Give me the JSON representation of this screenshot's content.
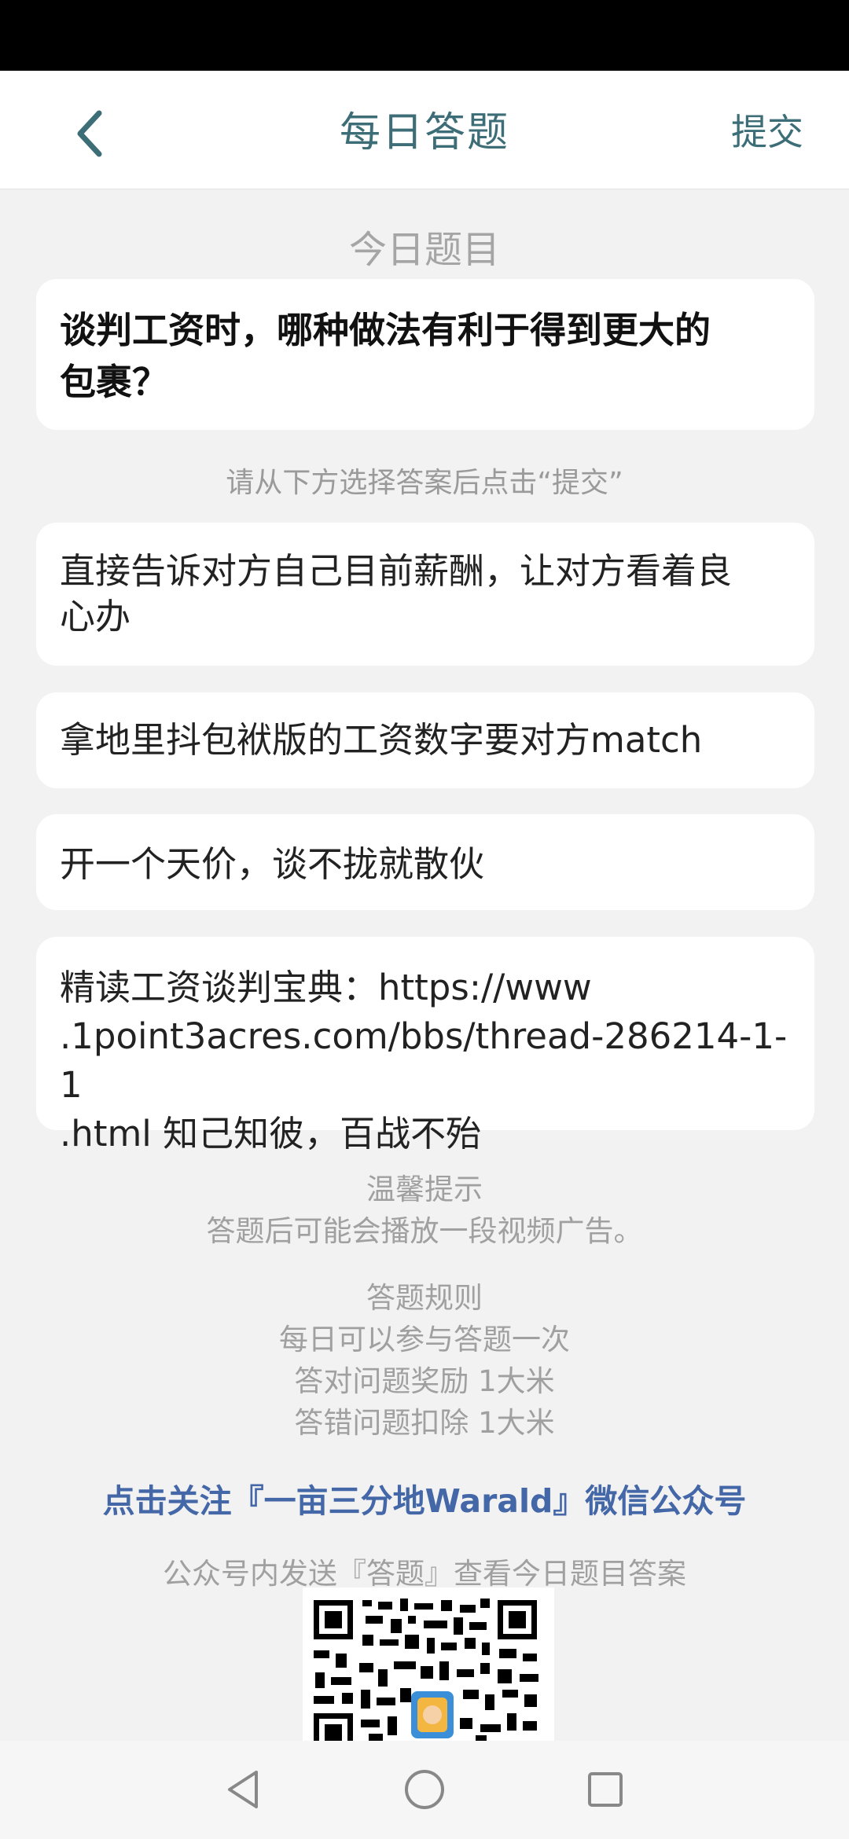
{
  "header": {
    "title": "每日答题",
    "submit_label": "提交"
  },
  "quiz": {
    "section_label": "今日题目",
    "question": "谈判工资时，哪种做法有利于得到更大的包裹？",
    "instruction": "请从下方选择答案后点击“提交”",
    "options": [
      "直接告诉对方自己目前薪酬，让对方看着良心办",
      "拿地里抖包袱版的工资数字要对方match",
      "开一个天价，谈不拢就散伙",
      "精读工资谈判宝典：https://www.1point3acres.com/bbs/thread-286214-1-1.html 知己知彼，百战不殆"
    ],
    "option4_lines": [
      "精读工资谈判宝典：https://www",
      ".1point3acres.com/bbs/thread-286214-1-1",
      ".html 知己知彼，百战不殆"
    ],
    "option1_lines": [
      "直接告诉对方自己目前薪酬，让对方看着良",
      "心办"
    ],
    "question_lines": [
      "谈判工资时，哪种做法有利于得到更大的",
      "包裹？"
    ]
  },
  "tips": {
    "title": "温馨提示",
    "text": "答题后可能会播放一段视频广告。"
  },
  "rules": {
    "title": "答题规则",
    "lines": [
      "每日可以参与答题一次",
      "答对问题奖励 1大米",
      "答错问题扣除 1大米"
    ]
  },
  "follow": {
    "link_text": "点击关注『一亩三分地Warald』微信公众号",
    "instruction": "公众号内发送『答题』查看今日题目答案"
  },
  "icons": {
    "back": "chevron-left-icon",
    "nav_back": "triangle-back-icon",
    "nav_home": "circle-home-icon",
    "nav_recents": "square-recents-icon"
  },
  "colors": {
    "accent": "#3d6e78",
    "link": "#4467a8"
  }
}
